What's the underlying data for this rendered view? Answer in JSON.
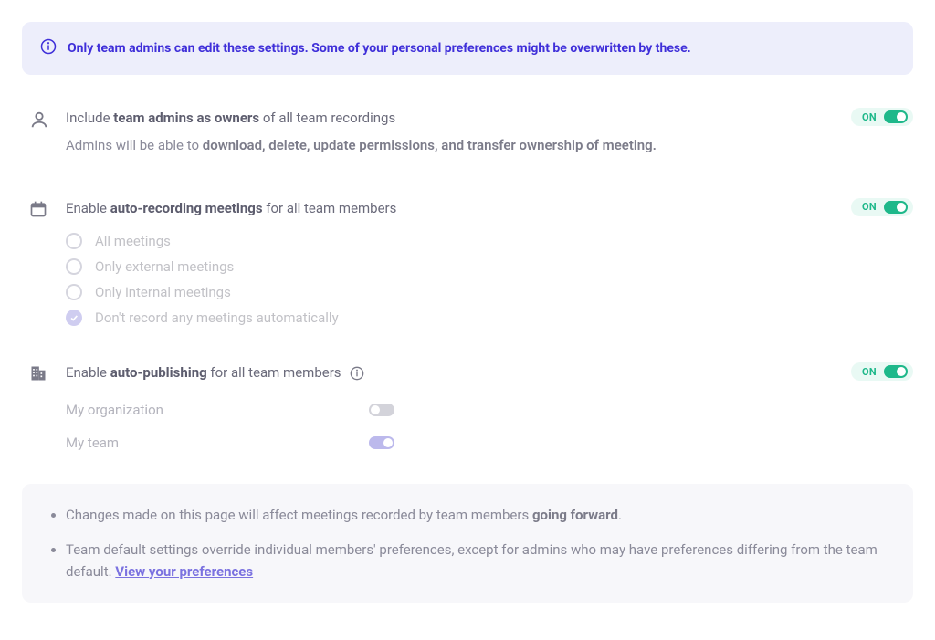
{
  "banner": {
    "text": "Only team admins can edit these settings. Some of your personal preferences might be overwritten by these."
  },
  "setting1": {
    "title_pre": "Include ",
    "title_bold": "team admins as owners",
    "title_post": " of all team recordings",
    "sub_pre": "Admins will be able to ",
    "sub_bold": "download, delete, update permissions, and transfer ownership of meeting.",
    "toggle_state": "ON"
  },
  "setting2": {
    "title_pre": "Enable ",
    "title_bold": "auto-recording meetings",
    "title_post": " for all team members",
    "toggle_state": "ON",
    "options": {
      "opt0": "All meetings",
      "opt1": "Only external meetings",
      "opt2": "Only internal meetings",
      "opt3": "Don't record any meetings automatically"
    }
  },
  "setting3": {
    "title_pre": "Enable ",
    "title_bold": "auto-publishing",
    "title_post": " for all team members",
    "toggle_state": "ON",
    "sub_toggles": {
      "org_label": "My organization",
      "team_label": "My team"
    }
  },
  "footer": {
    "item1_pre": "Changes made on this page will affect meetings recorded by team members ",
    "item1_bold": "going forward",
    "item1_post": ".",
    "item2_pre": "Team default settings override individual members' preferences, except for admins who may have preferences differing from the team default. ",
    "item2_link": "View your preferences"
  }
}
